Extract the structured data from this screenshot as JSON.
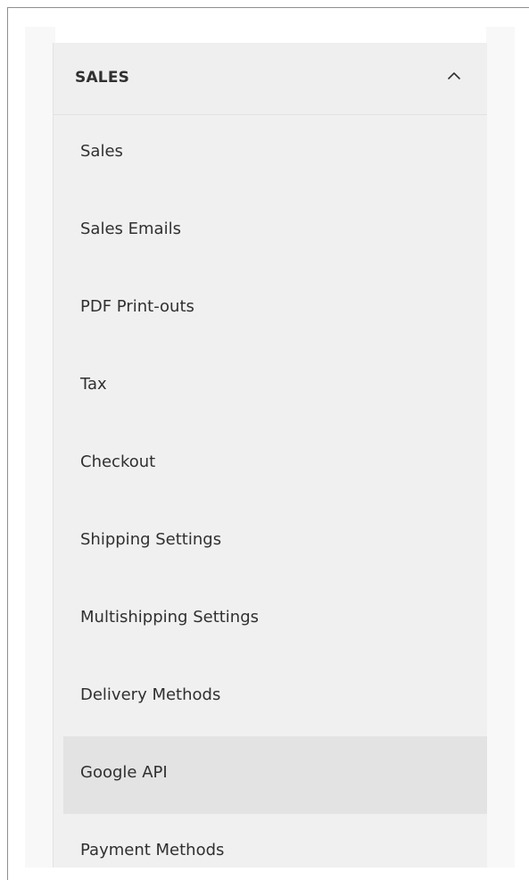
{
  "section": {
    "title": "SALES",
    "expanded": true,
    "toggle_icon": "chevron-up-icon"
  },
  "menu": {
    "items": [
      {
        "label": "Sales",
        "active": false
      },
      {
        "label": "Sales Emails",
        "active": false
      },
      {
        "label": "PDF Print-outs",
        "active": false
      },
      {
        "label": "Tax",
        "active": false
      },
      {
        "label": "Checkout",
        "active": false
      },
      {
        "label": "Shipping Settings",
        "active": false
      },
      {
        "label": "Multishipping Settings",
        "active": false
      },
      {
        "label": "Delivery Methods",
        "active": false
      },
      {
        "label": "Google API",
        "active": true
      },
      {
        "label": "Payment Methods",
        "active": false
      }
    ]
  },
  "colors": {
    "panel_bg": "#f0f0f0",
    "active_bg": "#e3e3e3",
    "text": "#303030",
    "frame_border": "#8f8f8f"
  }
}
